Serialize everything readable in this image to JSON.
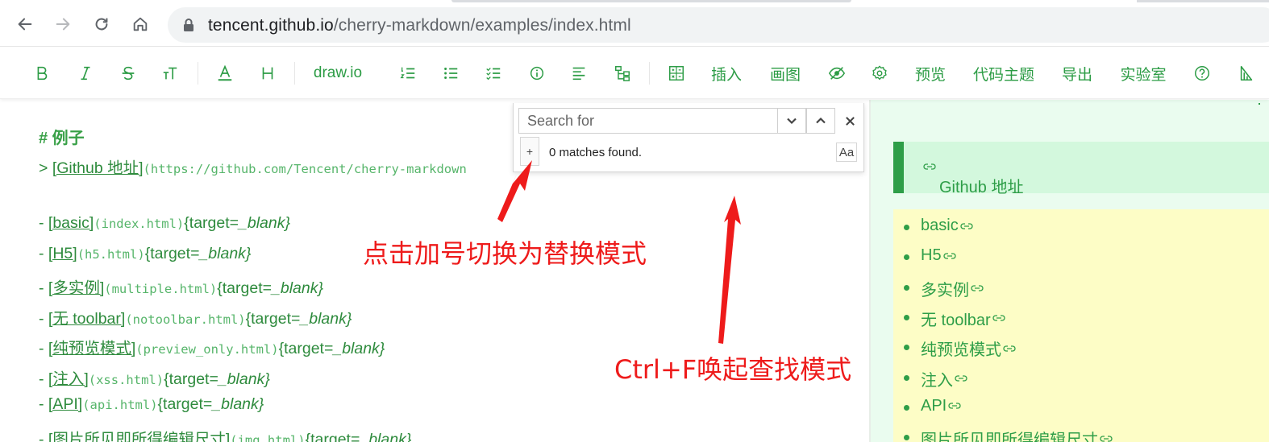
{
  "browser": {
    "url_host": "tencent.github.io",
    "url_path": "/cherry-markdown/examples/index.html"
  },
  "toolbar": {
    "drawio_label": "draw.io",
    "insert_label": "插入",
    "draw_label": "画图",
    "preview_label": "预览",
    "code_theme_label": "代码主题",
    "export_label": "导出",
    "lab_label": "实验室"
  },
  "editor": {
    "heading": "# 例子",
    "github_prefix": "> ",
    "github_text": "[Github 地址]",
    "github_url": "(https://github.com/Tencent/cherry-markdown",
    "items": [
      {
        "prefix": "- ",
        "text": "[basic]",
        "url": "(index.html)",
        "attr_open": "{target=",
        "attr_val": "_blank}"
      },
      {
        "prefix": "- ",
        "text": "[H5]",
        "url": "(h5.html)",
        "attr_open": "{target=",
        "attr_val": "_blank}"
      },
      {
        "prefix": "- ",
        "text": "[多实例]",
        "url": "(multiple.html)",
        "attr_open": "{target=",
        "attr_val": "_blank}"
      },
      {
        "prefix": "- ",
        "text": "[无 toolbar]",
        "url": "(notoolbar.html)",
        "attr_open": "{target=",
        "attr_val": "_blank}"
      },
      {
        "prefix": "- ",
        "text": "[纯预览模式]",
        "url": "(preview_only.html)",
        "attr_open": "{target=",
        "attr_val": "_blank}"
      },
      {
        "prefix": "- ",
        "text": "[注入]",
        "url": "(xss.html)",
        "attr_open": "{target=",
        "attr_val": "_blank}"
      },
      {
        "prefix": "- ",
        "text": "[API]",
        "url": "(api.html)",
        "attr_open": "{target=",
        "attr_val": "_blank}"
      },
      {
        "prefix": "- ",
        "text": "[图片所见即所得编辑尺寸]",
        "url": "(img.html)",
        "attr_open": "{target=",
        "attr_val": "_blank}"
      }
    ]
  },
  "search": {
    "placeholder": "Search for",
    "plus": "+",
    "matches": "0 matches found.",
    "case_toggle": "Aa"
  },
  "preview": {
    "blockquote_link": "Github 地址",
    "items": [
      "basic",
      "H5",
      "多实例",
      "无 toolbar",
      "纯预览模式",
      "注入",
      "API",
      "图片所见即所得编辑尺寸"
    ]
  },
  "annotations": {
    "replace_hint": "点击加号切换为替换模式",
    "find_hint": "Ctrl+F唤起查找模式"
  },
  "colors": {
    "accent": "#2c9c45",
    "annotation": "#ee1b1b",
    "preview_bg": "#eafcef",
    "list_bg": "#fdfdc6"
  }
}
